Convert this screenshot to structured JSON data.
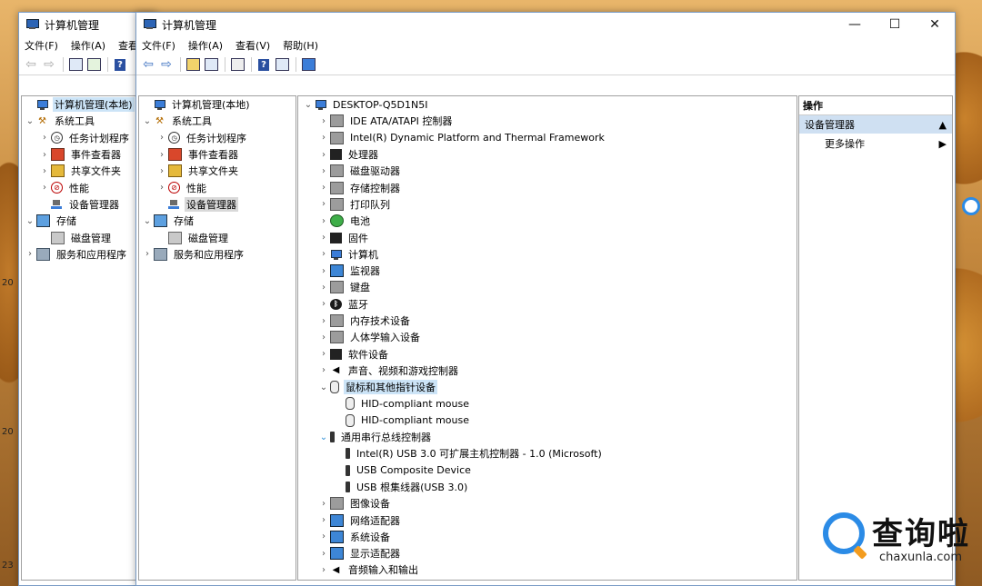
{
  "back_window": {
    "title": "计算机管理",
    "menu": [
      "文件(F)",
      "操作(A)",
      "查看"
    ],
    "tree": [
      {
        "label": "计算机管理(本地)",
        "chev": "",
        "indent": 0,
        "icon": "computer-icon",
        "selected": true
      },
      {
        "label": "系统工具",
        "chev": "v",
        "indent": 0,
        "icon": "tools-icon"
      },
      {
        "label": "任务计划程序",
        "chev": ">",
        "indent": 1,
        "icon": "clock-icon"
      },
      {
        "label": "事件查看器",
        "chev": ">",
        "indent": 1,
        "icon": "event-viewer-icon"
      },
      {
        "label": "共享文件夹",
        "chev": ">",
        "indent": 1,
        "icon": "shared-folder-icon"
      },
      {
        "label": "性能",
        "chev": ">",
        "indent": 1,
        "icon": "performance-icon"
      },
      {
        "label": "设备管理器",
        "chev": "",
        "indent": 1,
        "icon": "device-manager-icon"
      },
      {
        "label": "存储",
        "chev": "v",
        "indent": 0,
        "icon": "storage-icon"
      },
      {
        "label": "磁盘管理",
        "chev": "",
        "indent": 1,
        "icon": "disk-icon"
      },
      {
        "label": "服务和应用程序",
        "chev": ">",
        "indent": 0,
        "icon": "services-icon"
      }
    ]
  },
  "main_window": {
    "title": "计算机管理",
    "menu": [
      "文件(F)",
      "操作(A)",
      "查看(V)",
      "帮助(H)"
    ],
    "controls": {
      "minimize": "—",
      "maximize": "☐",
      "close": "✕"
    },
    "tree": [
      {
        "label": "计算机管理(本地)",
        "chev": "",
        "indent": 0,
        "icon": "computer-icon"
      },
      {
        "label": "系统工具",
        "chev": "v",
        "indent": 0,
        "icon": "tools-icon"
      },
      {
        "label": "任务计划程序",
        "chev": ">",
        "indent": 1,
        "icon": "clock-icon"
      },
      {
        "label": "事件查看器",
        "chev": ">",
        "indent": 1,
        "icon": "event-viewer-icon"
      },
      {
        "label": "共享文件夹",
        "chev": ">",
        "indent": 1,
        "icon": "shared-folder-icon"
      },
      {
        "label": "性能",
        "chev": ">",
        "indent": 1,
        "icon": "performance-icon"
      },
      {
        "label": "设备管理器",
        "chev": "",
        "indent": 1,
        "icon": "device-manager-icon",
        "selected": true
      },
      {
        "label": "存储",
        "chev": "v",
        "indent": 0,
        "icon": "storage-icon"
      },
      {
        "label": "磁盘管理",
        "chev": "",
        "indent": 1,
        "icon": "disk-icon"
      },
      {
        "label": "服务和应用程序",
        "chev": ">",
        "indent": 0,
        "icon": "services-icon"
      }
    ],
    "devices": [
      {
        "label": "DESKTOP-Q5D1N5I",
        "chev": "v",
        "indent": 0,
        "icon": "computer-icon"
      },
      {
        "label": "IDE ATA/ATAPI 控制器",
        "chev": ">",
        "indent": 1,
        "icon": "ide-controller-icon"
      },
      {
        "label": "Intel(R) Dynamic Platform and Thermal Framework",
        "chev": ">",
        "indent": 1,
        "icon": "thermal-icon"
      },
      {
        "label": "处理器",
        "chev": ">",
        "indent": 1,
        "icon": "processor-icon"
      },
      {
        "label": "磁盘驱动器",
        "chev": ">",
        "indent": 1,
        "icon": "disk-drive-icon"
      },
      {
        "label": "存储控制器",
        "chev": ">",
        "indent": 1,
        "icon": "storage-controller-icon"
      },
      {
        "label": "打印队列",
        "chev": ">",
        "indent": 1,
        "icon": "printer-icon"
      },
      {
        "label": "电池",
        "chev": ">",
        "indent": 1,
        "icon": "battery-icon"
      },
      {
        "label": "固件",
        "chev": ">",
        "indent": 1,
        "icon": "firmware-icon"
      },
      {
        "label": "计算机",
        "chev": ">",
        "indent": 1,
        "icon": "computer-icon"
      },
      {
        "label": "监视器",
        "chev": ">",
        "indent": 1,
        "icon": "monitor-icon"
      },
      {
        "label": "键盘",
        "chev": ">",
        "indent": 1,
        "icon": "keyboard-icon"
      },
      {
        "label": "蓝牙",
        "chev": ">",
        "indent": 1,
        "icon": "bluetooth-icon"
      },
      {
        "label": "内存技术设备",
        "chev": ">",
        "indent": 1,
        "icon": "memory-icon"
      },
      {
        "label": "人体学输入设备",
        "chev": ">",
        "indent": 1,
        "icon": "hid-icon"
      },
      {
        "label": "软件设备",
        "chev": ">",
        "indent": 1,
        "icon": "software-device-icon"
      },
      {
        "label": "声音、视频和游戏控制器",
        "chev": ">",
        "indent": 1,
        "icon": "speaker-icon"
      },
      {
        "label": "鼠标和其他指针设备",
        "chev": "v",
        "indent": 1,
        "icon": "mouse-icon",
        "selected": true
      },
      {
        "label": "HID-compliant mouse",
        "chev": "",
        "indent": 2,
        "icon": "mouse-icon"
      },
      {
        "label": "HID-compliant mouse",
        "chev": "",
        "indent": 2,
        "icon": "mouse-icon"
      },
      {
        "label": "通用串行总线控制器",
        "chev": "vb",
        "indent": 1,
        "icon": "usb-icon"
      },
      {
        "label": "Intel(R) USB 3.0 可扩展主机控制器 - 1.0 (Microsoft)",
        "chev": "",
        "indent": 2,
        "icon": "usb-icon"
      },
      {
        "label": "USB Composite Device",
        "chev": "",
        "indent": 2,
        "icon": "usb-icon"
      },
      {
        "label": "USB 根集线器(USB 3.0)",
        "chev": "",
        "indent": 2,
        "icon": "usb-icon"
      },
      {
        "label": "图像设备",
        "chev": ">",
        "indent": 1,
        "icon": "camera-icon"
      },
      {
        "label": "网络适配器",
        "chev": ">",
        "indent": 1,
        "icon": "network-icon"
      },
      {
        "label": "系统设备",
        "chev": ">",
        "indent": 1,
        "icon": "system-device-icon"
      },
      {
        "label": "显示适配器",
        "chev": ">",
        "indent": 1,
        "icon": "display-adapter-icon"
      },
      {
        "label": "音频输入和输出",
        "chev": ">",
        "indent": 1,
        "icon": "audio-icon"
      }
    ],
    "actions": {
      "header": "操作",
      "section": "设备管理器",
      "more": "更多操作"
    }
  },
  "desktop_labels": [
    "20",
    "20",
    "23"
  ],
  "watermark": {
    "brand": "查询啦",
    "domain": "chaxunla.com"
  },
  "colors": {
    "accent": "#2b8be6",
    "selection": "#cce4f7",
    "logo_orange": "#f39c1f"
  }
}
